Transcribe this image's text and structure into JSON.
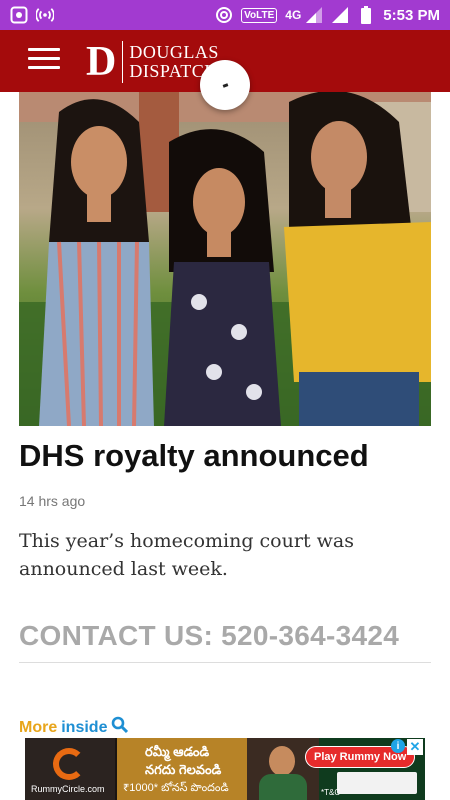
{
  "status_bar": {
    "network_type": "4G",
    "volte_label": "VoLTE",
    "time": "5:53 PM",
    "icons": [
      "screenshot-icon",
      "hotspot-icon",
      "wifi-calling-icon",
      "signal-icon",
      "battery-icon"
    ]
  },
  "header": {
    "logo_letter": "D",
    "logo_line1": "DOUGLAS",
    "logo_line2": "DISPATCH",
    "menu_icon": "hamburger-menu-icon",
    "bar_color": "#a40b0c"
  },
  "article": {
    "headline": "DHS royalty announced",
    "timestamp": "14 hrs ago",
    "summary": "This year’s homecoming court was announced last week.",
    "image_subject": "three young women posing outdoors"
  },
  "contact": {
    "text": "CONTACT US: 520-364-3424"
  },
  "more_inside": {
    "word1": "More",
    "word2": "inside",
    "icon": "search-icon"
  },
  "ad": {
    "brand": "RummyCircle.com",
    "telugu_line1": "రమ్మీ ఆడండి",
    "telugu_line2": "నగదు గెలవండి",
    "amount_line": "₹1000* బోనస్ పొందండి",
    "cta": "Play Rummy Now",
    "tc": "*T&C"
  }
}
